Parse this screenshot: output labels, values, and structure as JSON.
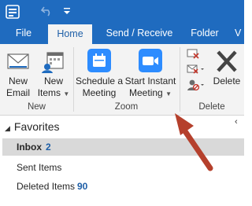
{
  "tabs": [
    {
      "label": "File"
    },
    {
      "label": "Home"
    },
    {
      "label": "Send / Receive"
    },
    {
      "label": "Folder"
    },
    {
      "label": "V"
    }
  ],
  "ribbon": {
    "new_email": {
      "line1": "New",
      "line2": "Email"
    },
    "new_items": {
      "line1": "New",
      "line2": "Items"
    },
    "schedule_meeting": {
      "line1": "Schedule a",
      "line2": "Meeting"
    },
    "start_instant_meeting": {
      "line1": "Start Instant",
      "line2": "Meeting"
    },
    "delete_label": "Delete",
    "groups": {
      "new": "New",
      "zoom": "Zoom",
      "delete": "Delete"
    }
  },
  "folder_pane": {
    "favorites_label": "Favorites",
    "items": [
      {
        "name": "Inbox",
        "count": "2"
      },
      {
        "name": "Sent Items",
        "count": ""
      },
      {
        "name": "Deleted Items",
        "count": "90"
      }
    ]
  },
  "colors": {
    "accent": "#1f6bbf",
    "annotation_arrow": "#b5402c",
    "zoom_blue": "#2d8cff"
  }
}
